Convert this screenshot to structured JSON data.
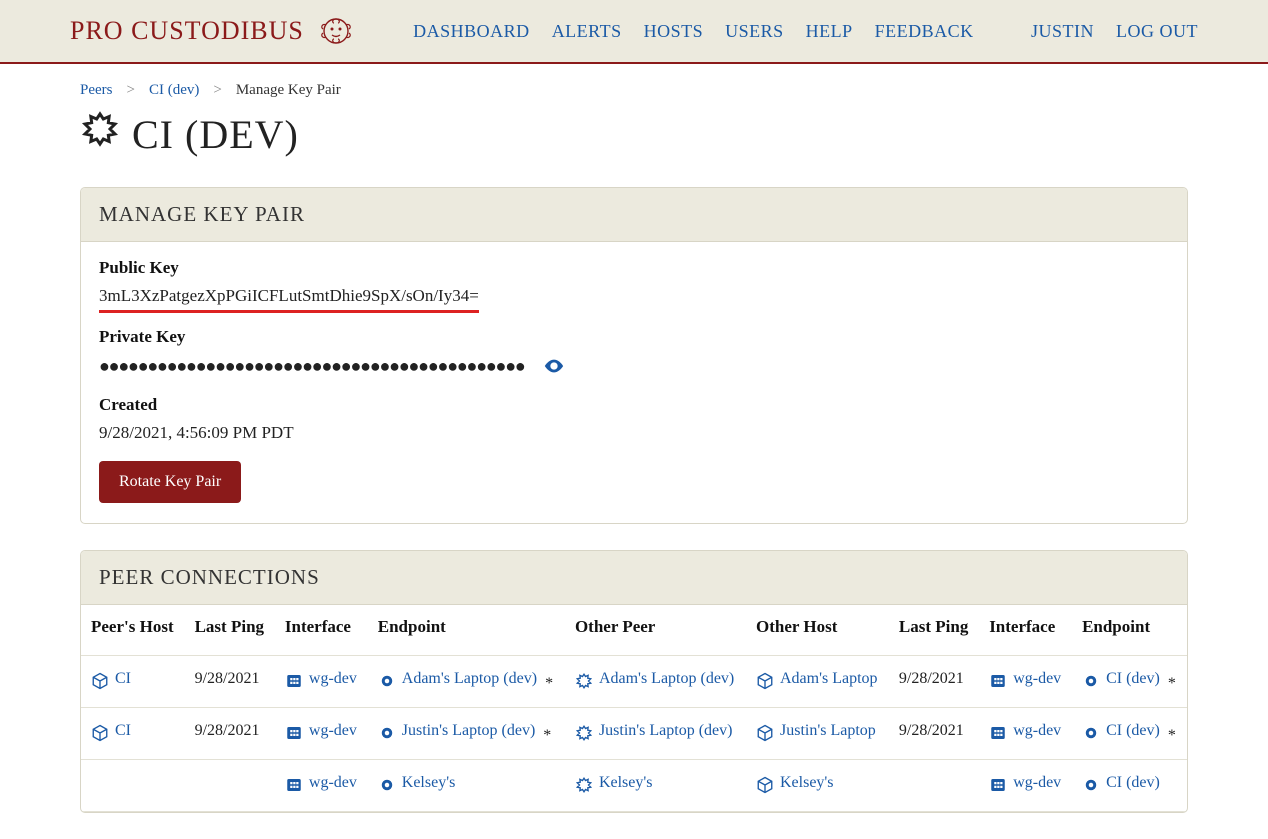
{
  "brand": "PRO CUSTODIBUS",
  "nav": {
    "dashboard": "DASHBOARD",
    "alerts": "ALERTS",
    "hosts": "HOSTS",
    "users": "USERS",
    "help": "HELP",
    "feedback": "FEEDBACK"
  },
  "usernav": {
    "user": "JUSTIN",
    "logout": "LOG OUT"
  },
  "breadcrumb": {
    "peers": "Peers",
    "cidev": "CI (dev)",
    "current": "Manage Key Pair"
  },
  "page_title": "CI (DEV)",
  "manage": {
    "panel_title": "MANAGE KEY PAIR",
    "public_key_label": "Public Key",
    "public_key_value": "3mL3XzPatgezXpPGiICFLutSmtDhie9SpX/sOn/Iy34=",
    "private_key_label": "Private Key",
    "private_key_masked": "●●●●●●●●●●●●●●●●●●●●●●●●●●●●●●●●●●●●●●●●●●●●",
    "created_label": "Created",
    "created_value": "9/28/2021, 4:56:09 PM PDT",
    "rotate_button": "Rotate Key Pair"
  },
  "connections": {
    "panel_title": "PEER CONNECTIONS",
    "headers": {
      "peers_host": "Peer's Host",
      "last_ping1": "Last Ping",
      "interface1": "Interface",
      "endpoint1": "Endpoint",
      "other_peer": "Other Peer",
      "other_host": "Other Host",
      "last_ping2": "Last Ping",
      "interface2": "Interface",
      "endpoint2": "Endpoint"
    },
    "rows": [
      {
        "peers_host": "CI",
        "last_ping1": "9/28/2021",
        "interface1": "wg-dev",
        "endpoint1": "Adam's Laptop (dev)",
        "endpoint1_star": " *",
        "other_peer": "Adam's Laptop (dev)",
        "other_host": "Adam's Laptop",
        "last_ping2": "9/28/2021",
        "interface2": "wg-dev",
        "endpoint2": "CI (dev)",
        "endpoint2_star": " *"
      },
      {
        "peers_host": "CI",
        "last_ping1": "9/28/2021",
        "interface1": "wg-dev",
        "endpoint1": "Justin's Laptop (dev)",
        "endpoint1_star": " *",
        "other_peer": "Justin's Laptop (dev)",
        "other_host": "Justin's Laptop",
        "last_ping2": "9/28/2021",
        "interface2": "wg-dev",
        "endpoint2": "CI (dev)",
        "endpoint2_star": " *"
      },
      {
        "peers_host": "",
        "last_ping1": "",
        "interface1": "wg-dev",
        "endpoint1": "Kelsey's",
        "endpoint1_star": "",
        "other_peer": "Kelsey's",
        "other_host": "Kelsey's",
        "last_ping2": "",
        "interface2": "wg-dev",
        "endpoint2": "CI (dev)",
        "endpoint2_star": ""
      }
    ]
  }
}
